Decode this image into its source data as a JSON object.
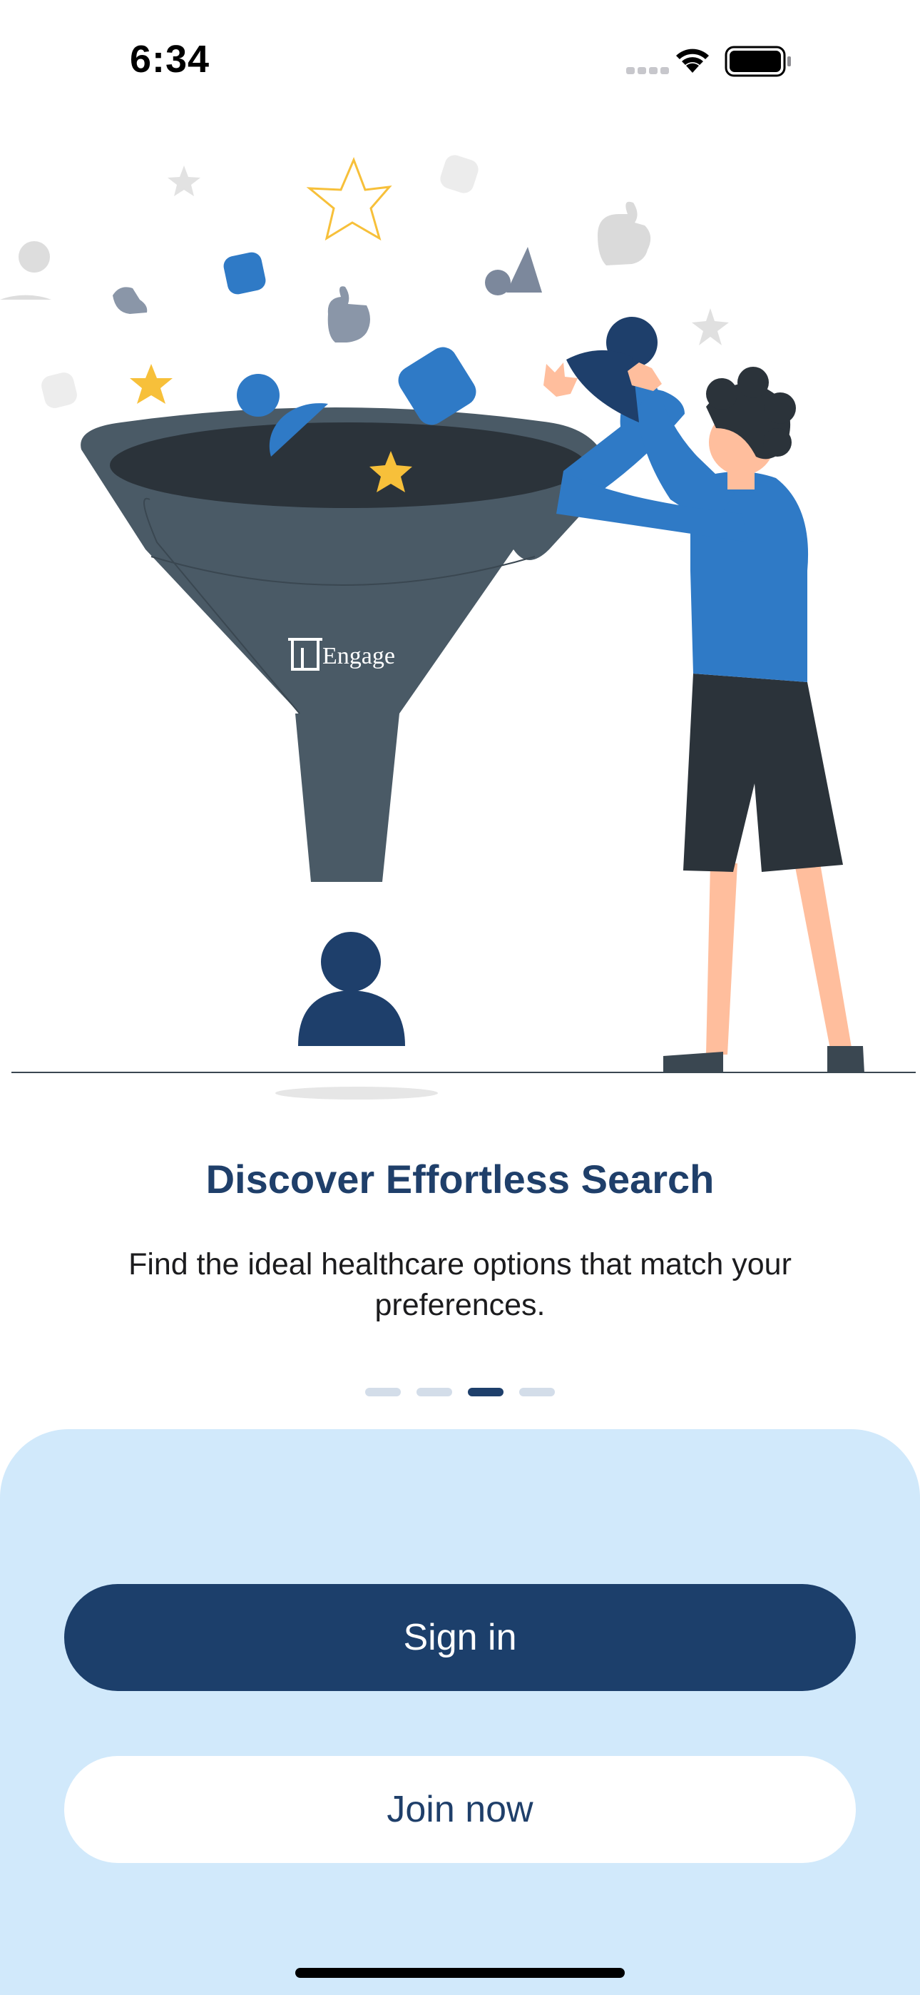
{
  "status_bar": {
    "time": "6:34"
  },
  "illustration": {
    "logo_text": "Engage"
  },
  "onboarding": {
    "title": "Discover Effortless Search",
    "subtitle": "Find the ideal healthcare options that match your preferences.",
    "pages": {
      "total": 4,
      "active_index": 2
    }
  },
  "actions": {
    "sign_in_label": "Sign in",
    "join_label": "Join now"
  },
  "colors": {
    "brand_navy": "#1c3f6b",
    "accent_blue": "#2f7ac6",
    "panel_bg": "#d1e9fb",
    "funnel_gray": "#4a5a66",
    "star_yellow": "#f7c03a"
  }
}
